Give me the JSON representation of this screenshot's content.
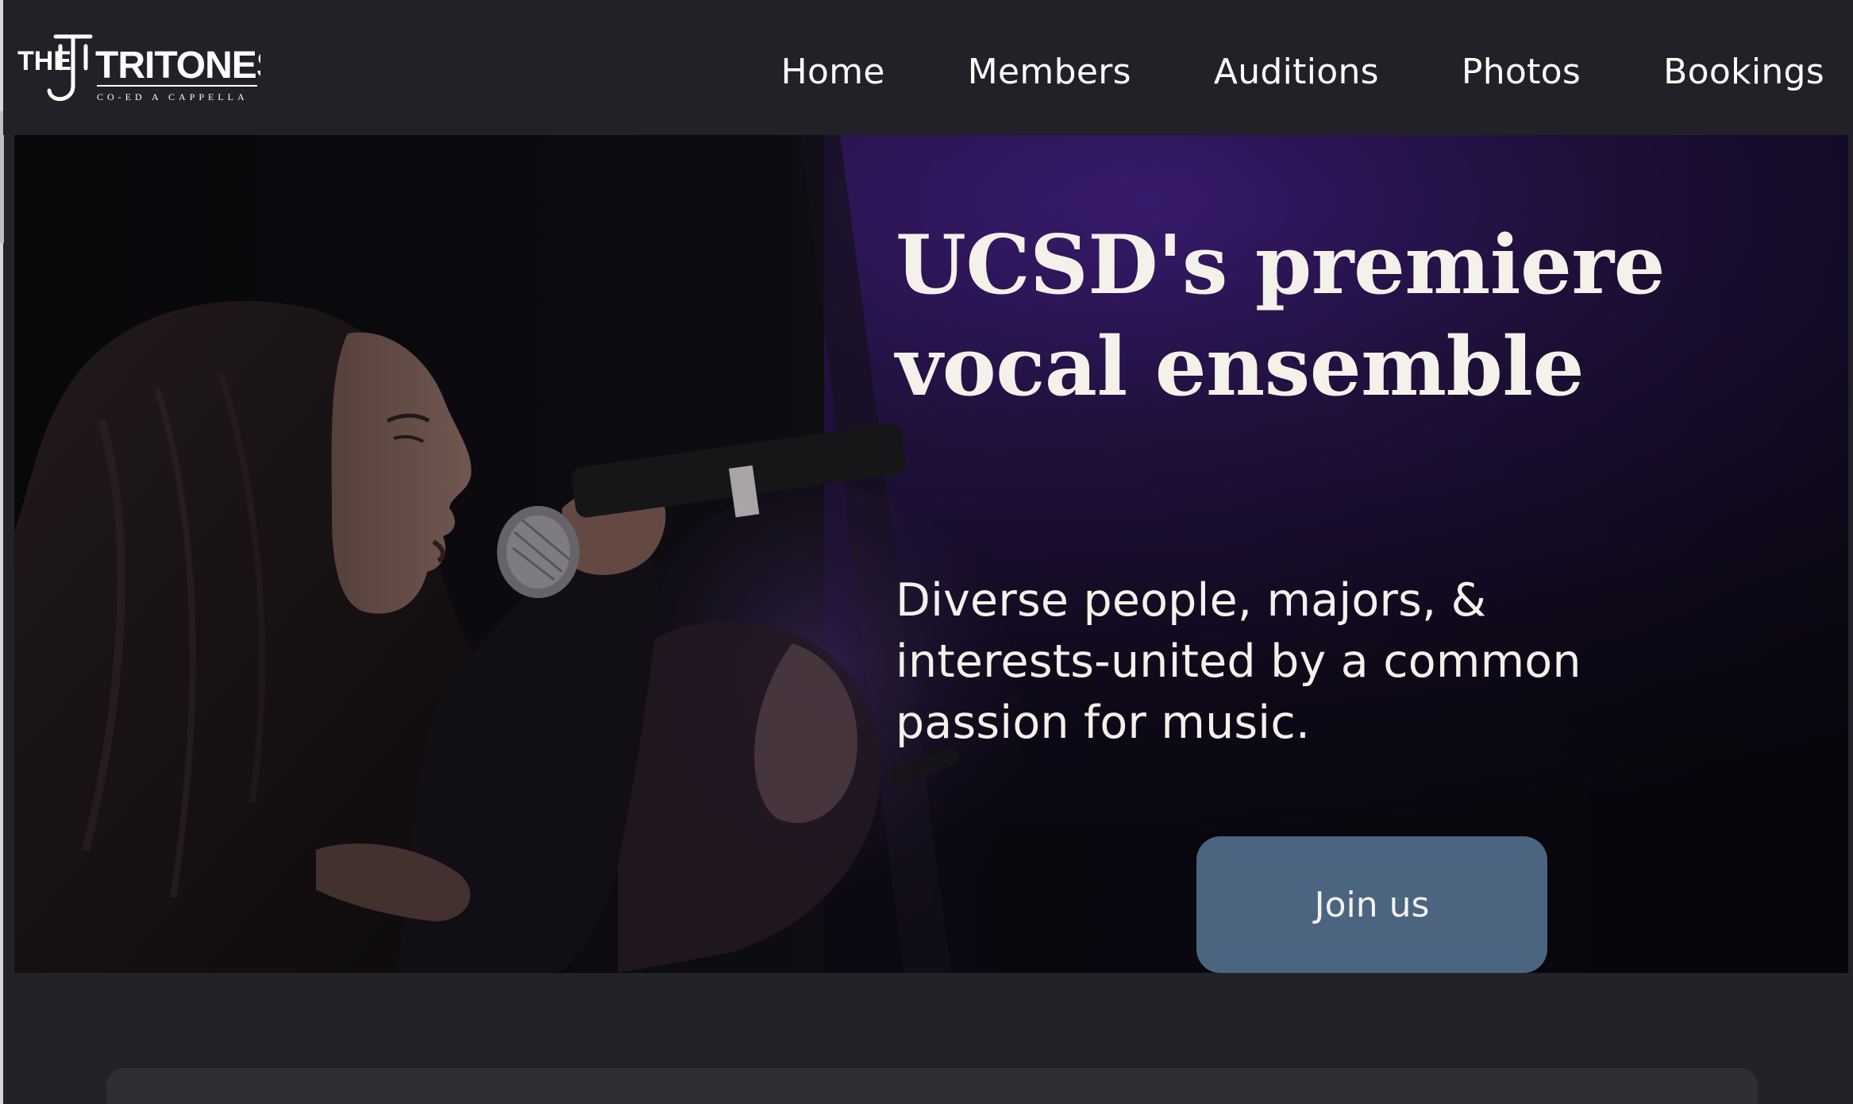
{
  "logo": {
    "the": "THE",
    "name": "TRITONES",
    "tagline": "CO-ED A CAPPELLA"
  },
  "nav": {
    "items": [
      {
        "label": "Home"
      },
      {
        "label": "Members"
      },
      {
        "label": "Auditions"
      },
      {
        "label": "Photos"
      },
      {
        "label": "Bookings"
      }
    ]
  },
  "hero": {
    "title": "UCSD's premiere vocal ensemble",
    "subtitle": "Diverse people, majors, & interests-united by a common passion for music.",
    "cta_label": "Join us"
  },
  "colors": {
    "background": "#222228",
    "header": "#212127",
    "hero_text": "#f4f1ea",
    "button": "#4b6580",
    "stage_purple": "#3a1f66"
  }
}
